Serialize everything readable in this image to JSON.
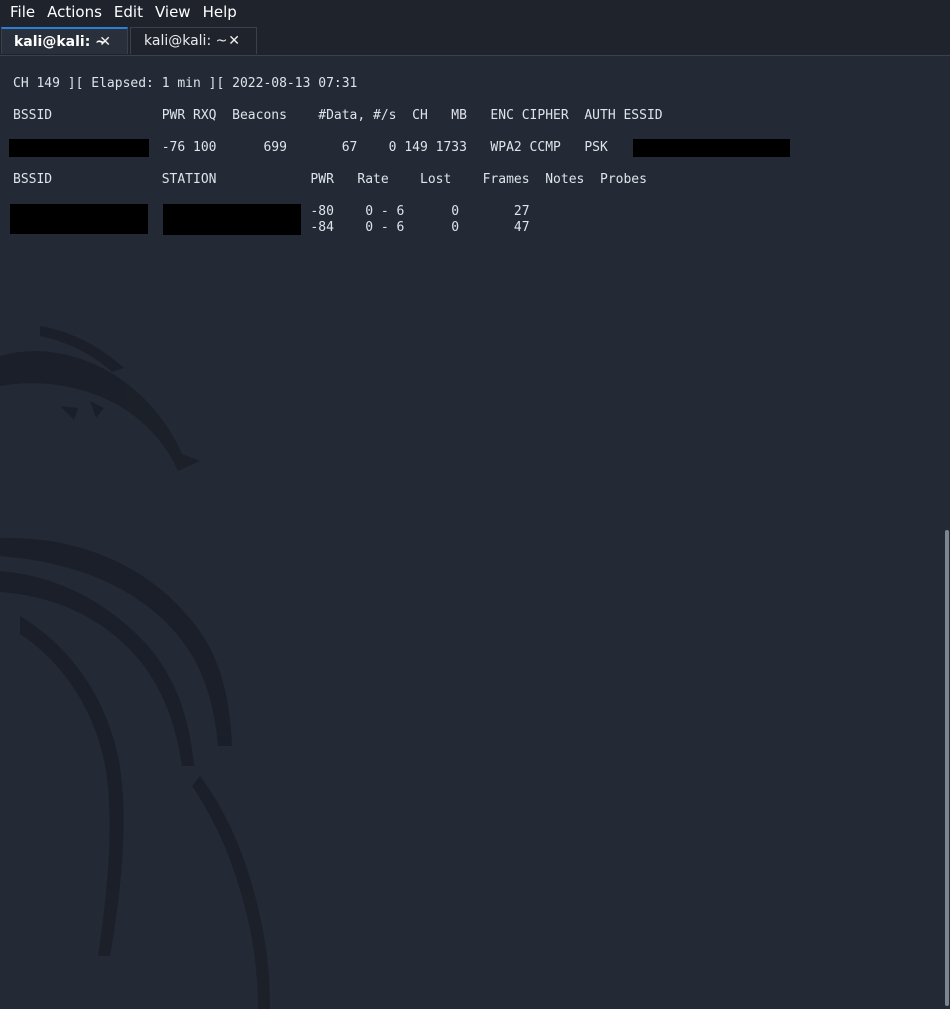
{
  "menubar": {
    "items": [
      "File",
      "Actions",
      "Edit",
      "View",
      "Help"
    ]
  },
  "tabs": [
    {
      "label": "kali@kali: ~",
      "close": "✕",
      "active": true
    },
    {
      "label": "kali@kali: ~",
      "close": "✕",
      "active": false
    }
  ],
  "terminal": {
    "status_line": "CH 149 ][ Elapsed: 1 min ][ 2022-08-13 07:31",
    "ap_header": "BSSID              PWR RXQ  Beacons    #Data, #/s  CH   MB   ENC CIPHER  AUTH ESSID",
    "ap_row": "                   -76 100      699       67    0 149 1733   WPA2 CCMP   PSK",
    "station_header": "BSSID              STATION            PWR   Rate    Lost    Frames  Notes  Probes",
    "station_rows": [
      "                                      -80    0 - 6      0       27",
      "                                      -84    0 - 6      0       47"
    ]
  },
  "colors": {
    "background": "#232935",
    "menubar": "#1f232c",
    "active_tab_accent": "#2c7fd6",
    "text": "#dfe3ea",
    "redaction": "#000000"
  },
  "icons": {
    "tab_close": "close-icon",
    "background": "kali-dragon-watermark"
  }
}
